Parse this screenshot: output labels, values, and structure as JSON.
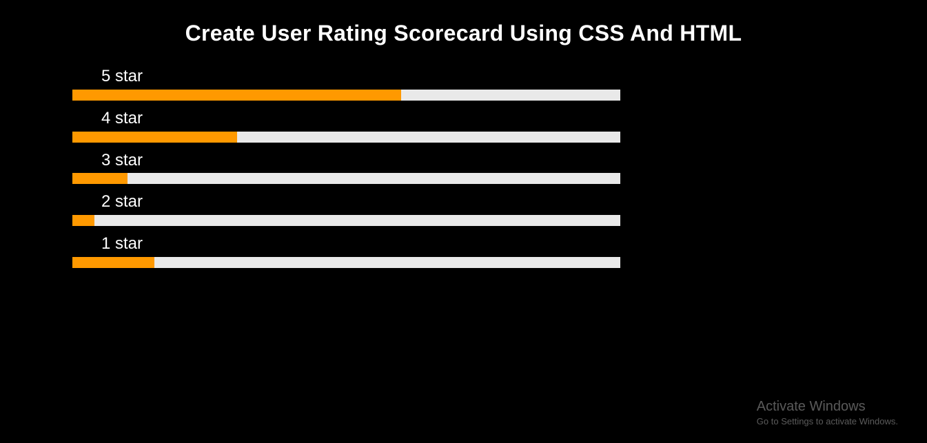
{
  "title": "Create User Rating Scorecard Using CSS And HTML",
  "chart_data": {
    "type": "bar",
    "categories": [
      "5 star",
      "4 star",
      "3 star",
      "2 star",
      "1 star"
    ],
    "values": [
      60,
      30,
      10,
      4,
      15
    ],
    "title": "User Rating Scorecard",
    "xlabel": "",
    "ylabel": "",
    "ylim": [
      0,
      100
    ]
  },
  "ratings": {
    "items": [
      {
        "label": "5 star",
        "percent": 60
      },
      {
        "label": "4 star",
        "percent": 30
      },
      {
        "label": "3 star",
        "percent": 10
      },
      {
        "label": "2 star",
        "percent": 4
      },
      {
        "label": "1 star",
        "percent": 15
      }
    ]
  },
  "colors": {
    "bar_fill": "#ff9900",
    "bar_track": "#e9e9e9",
    "background": "#000000",
    "text": "#ffffff"
  },
  "watermark": {
    "title": "Activate Windows",
    "subtitle": "Go to Settings to activate Windows."
  }
}
